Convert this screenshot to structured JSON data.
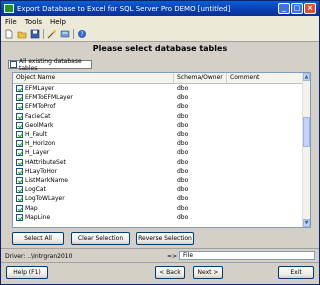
{
  "window": {
    "title": "Export Database to Excel for SQL Server Pro DEMO [untitled]",
    "controls": {
      "minimize": "_",
      "maximize": "□",
      "close": "×"
    }
  },
  "menu": {
    "items": [
      "File",
      "Tools",
      "Help"
    ]
  },
  "toolbar": {
    "icons": [
      "new-document-icon",
      "open-folder-icon",
      "save-icon",
      "wizard-icon",
      "settings-icon",
      "help-icon"
    ]
  },
  "heading": "Please select database tables",
  "all_tables_checkbox": {
    "label": "All existing database tables",
    "checked": false
  },
  "table": {
    "columns": [
      "Object Name",
      "Schema/Owner",
      "Comment"
    ],
    "rows": [
      {
        "name": "EFMLayer",
        "owner": "dbo",
        "comment": "",
        "checked": true
      },
      {
        "name": "EFMToEFMLayer",
        "owner": "dbo",
        "comment": "",
        "checked": true
      },
      {
        "name": "EFMToProf",
        "owner": "dbo",
        "comment": "",
        "checked": true
      },
      {
        "name": "FacieCat",
        "owner": "dbo",
        "comment": "",
        "checked": true
      },
      {
        "name": "GeolMark",
        "owner": "dbo",
        "comment": "",
        "checked": true
      },
      {
        "name": "H_Fault",
        "owner": "dbo",
        "comment": "",
        "checked": true
      },
      {
        "name": "H_Horizon",
        "owner": "dbo",
        "comment": "",
        "checked": true
      },
      {
        "name": "H_Layer",
        "owner": "dbo",
        "comment": "",
        "checked": true
      },
      {
        "name": "HAttributeSet",
        "owner": "dbo",
        "comment": "",
        "checked": true
      },
      {
        "name": "HLayToHor",
        "owner": "dbo",
        "comment": "",
        "checked": true
      },
      {
        "name": "ListMarkName",
        "owner": "dbo",
        "comment": "",
        "checked": true
      },
      {
        "name": "LogCat",
        "owner": "dbo",
        "comment": "",
        "checked": true
      },
      {
        "name": "LogToWLayer",
        "owner": "dbo",
        "comment": "",
        "checked": true
      },
      {
        "name": "Map",
        "owner": "dbo",
        "comment": "",
        "checked": true
      },
      {
        "name": "MapLine",
        "owner": "dbo",
        "comment": "",
        "checked": true
      }
    ],
    "scrollbar": {
      "up": "▲",
      "down": "▼"
    }
  },
  "buttons": {
    "select_all": "Select All",
    "clear_selection": "Clear Selection",
    "reverse_selection": "Reverse Selection",
    "help": "Help (F1)",
    "back": "< Back",
    "next": "Next >",
    "exit": "Exit"
  },
  "status": {
    "driver": "Driver: ..\\Intrgran2010",
    "arrow": "=>",
    "file": "File"
  },
  "colors": {
    "titlebar": "#0a3fb0",
    "window_bg": "#d4d0c8",
    "checkmark": "#21a121"
  }
}
